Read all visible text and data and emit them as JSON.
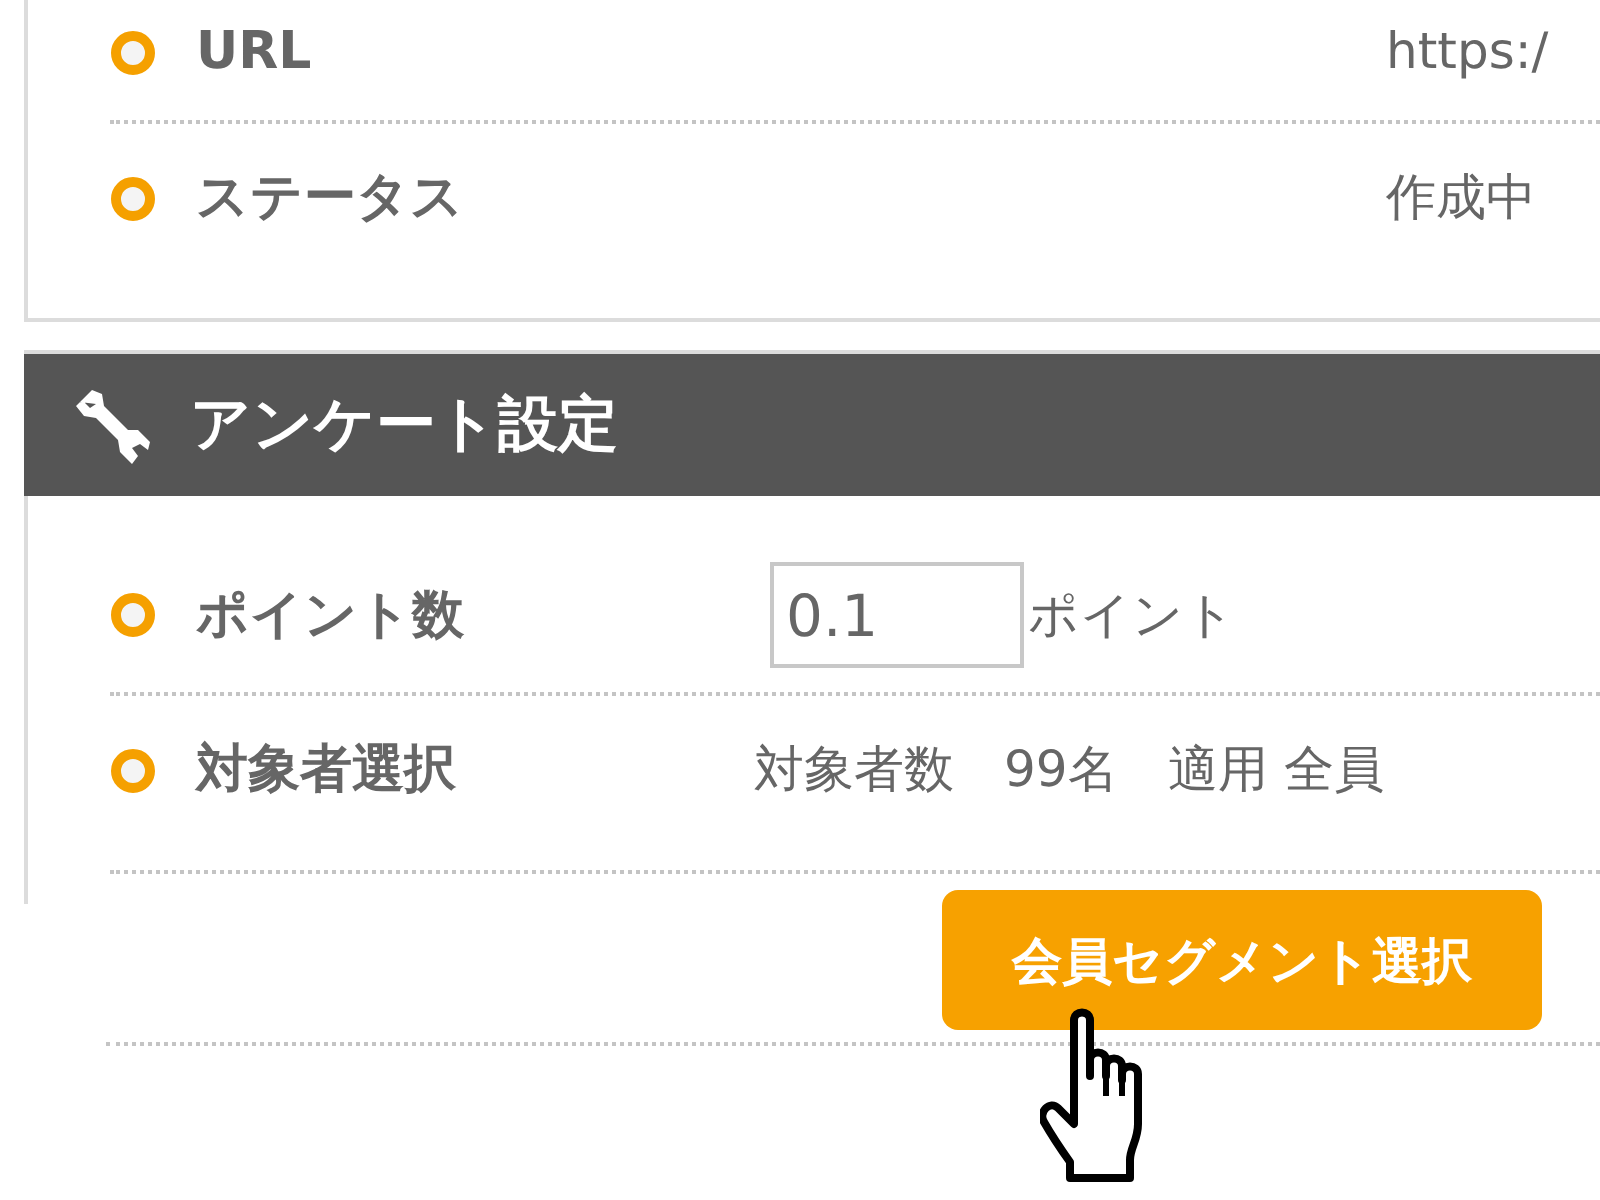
{
  "info_rows": [
    {
      "label": "URL",
      "value": "https:/"
    },
    {
      "label": "ステータス",
      "value": "作成中"
    }
  ],
  "survey_settings": {
    "title": "アンケート設定",
    "rows": [
      {
        "kind": "input",
        "label": "ポイント数",
        "value": "0.1",
        "unit": "ポイント"
      },
      {
        "kind": "text",
        "label": "対象者選択",
        "value": "対象者数　99名　適用 全員"
      }
    ],
    "button": "会員セグメント選択"
  }
}
